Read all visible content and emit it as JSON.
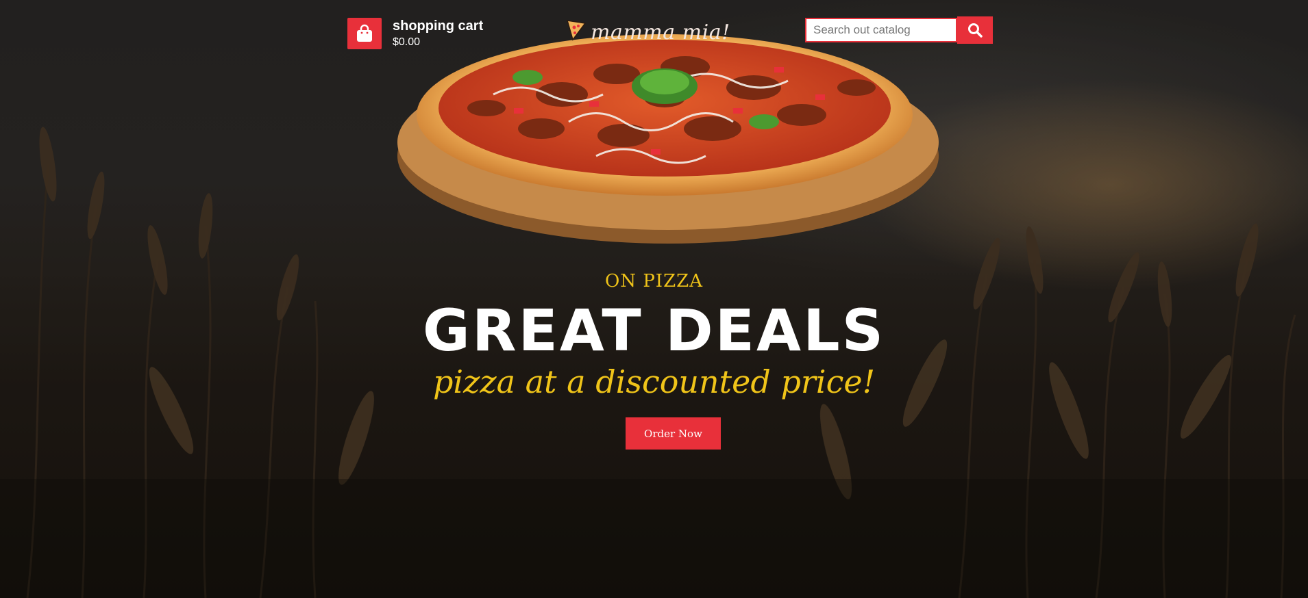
{
  "header": {
    "cart": {
      "title": "shopping cart",
      "total": "$0.00",
      "icon": "shopping-bag-icon"
    },
    "logo": {
      "text": "mamma mia!",
      "icon": "pizza-slice-icon"
    },
    "search": {
      "placeholder": "Search out catalog",
      "button_icon": "search-icon"
    }
  },
  "hero": {
    "kicker": "ON PIZZA",
    "headline": "GREAT DEALS",
    "tagline": "pizza at a discounted price!",
    "cta_label": "Order Now"
  },
  "colors": {
    "accent": "#e8303a",
    "highlight": "#f0c419"
  }
}
